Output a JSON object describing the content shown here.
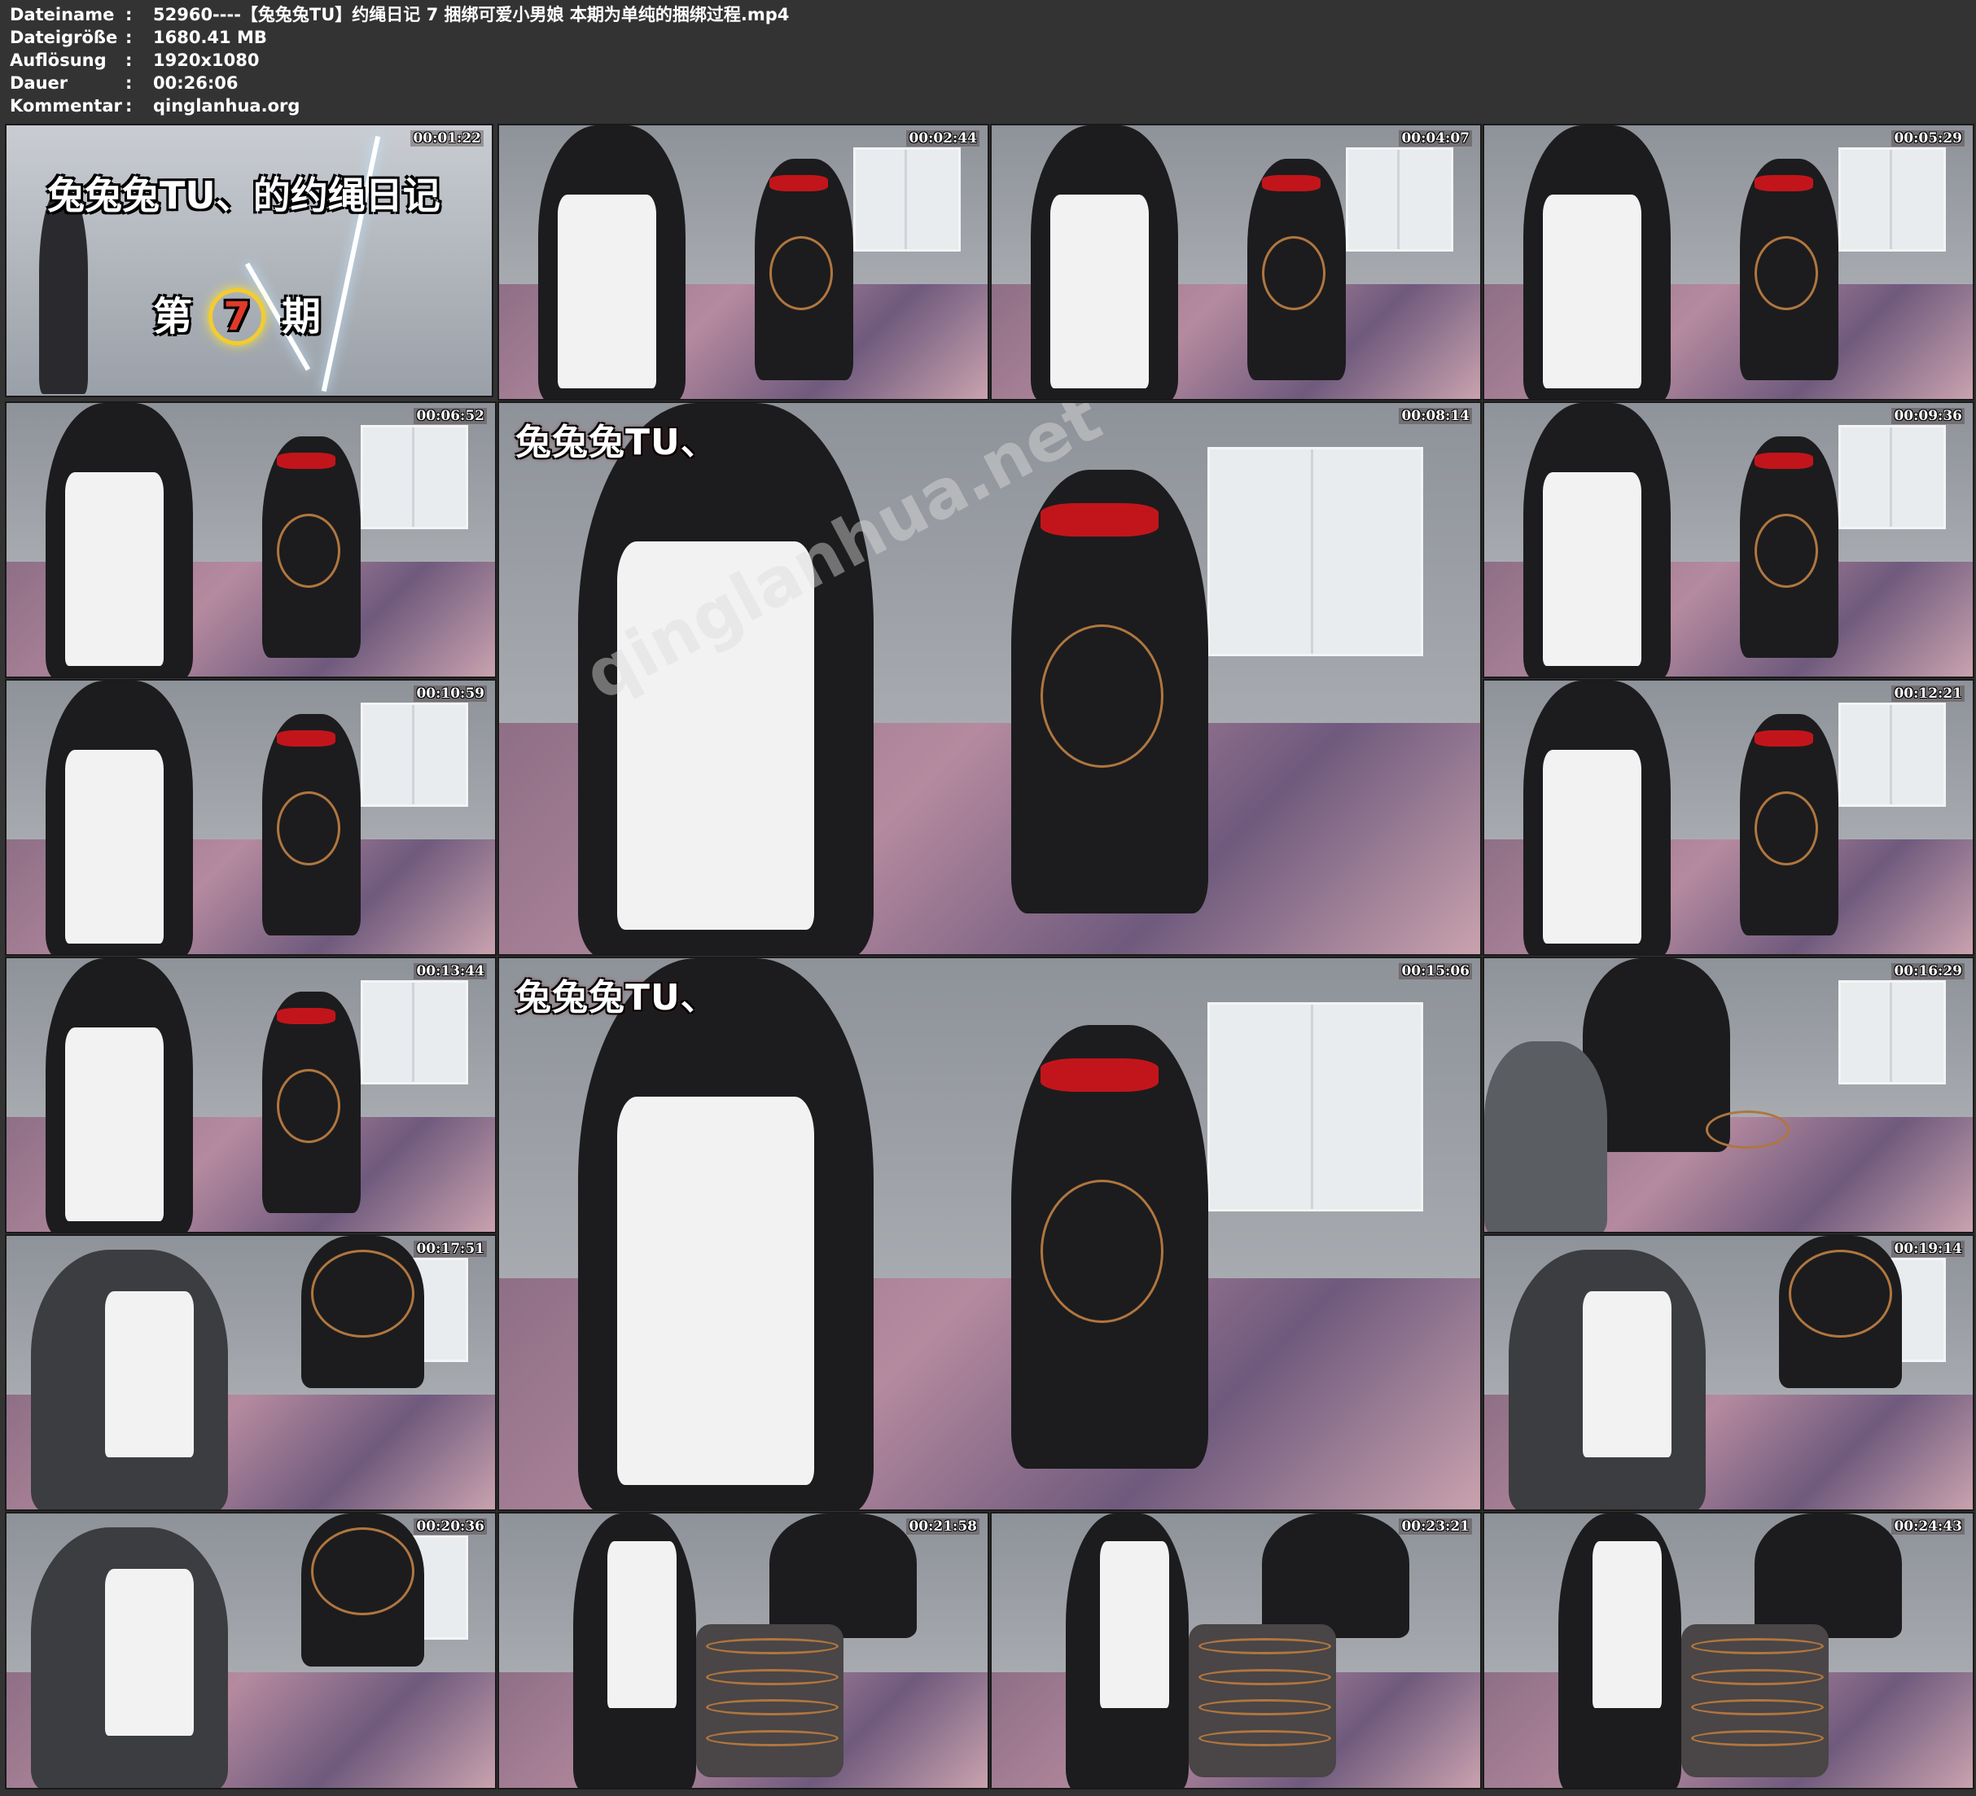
{
  "header": {
    "rows": [
      {
        "key": "Dateiname",
        "sep": ":",
        "value": "52960----【兔兔兔TU】约绳日记 7 捆绑可爱小男娘 本期为单纯的捆绑过程.mp4"
      },
      {
        "key": "Dateigröße",
        "sep": ":",
        "value": "1680.41 MB"
      },
      {
        "key": "Auflösung",
        "sep": ":",
        "value": "1920x1080"
      },
      {
        "key": "Dauer",
        "sep": ":",
        "value": "00:26:06"
      },
      {
        "key": "Kommentar",
        "sep": ":",
        "value": "qinglanhua.org"
      }
    ]
  },
  "title_card": {
    "title": "兔兔兔TU、的约绳日记",
    "issue_prefix": "第",
    "issue_number": "7",
    "issue_suffix": "期",
    "timestamp": "00:01:22"
  },
  "thumbnails": [
    {
      "id": "t02",
      "timestamp": "00:02:44"
    },
    {
      "id": "t03",
      "timestamp": "00:04:07"
    },
    {
      "id": "t04",
      "timestamp": "00:05:29"
    },
    {
      "id": "t05",
      "timestamp": "00:06:52"
    },
    {
      "id": "t06",
      "timestamp": "00:08:14",
      "logo": "兔兔兔TU、"
    },
    {
      "id": "t07",
      "timestamp": "00:09:36"
    },
    {
      "id": "t08",
      "timestamp": "00:10:59"
    },
    {
      "id": "t09",
      "timestamp": "00:12:21"
    },
    {
      "id": "t10",
      "timestamp": "00:13:44"
    },
    {
      "id": "t11",
      "timestamp": "00:15:06",
      "logo": "兔兔兔TU、"
    },
    {
      "id": "t12",
      "timestamp": "00:16:29"
    },
    {
      "id": "t13",
      "timestamp": "00:17:51"
    },
    {
      "id": "t14",
      "timestamp": "00:19:14"
    },
    {
      "id": "t15",
      "timestamp": "00:20:36"
    },
    {
      "id": "t16",
      "timestamp": "00:21:58"
    },
    {
      "id": "t17",
      "timestamp": "00:23:21"
    },
    {
      "id": "t18",
      "timestamp": "00:24:43"
    }
  ],
  "watermark": "qinglanhua.net",
  "colors": {
    "background": "#333333",
    "text": "#ffffff",
    "blindfold": "#c2151b",
    "rope": "#b0763f",
    "bedsheet": "#8e6f86"
  }
}
